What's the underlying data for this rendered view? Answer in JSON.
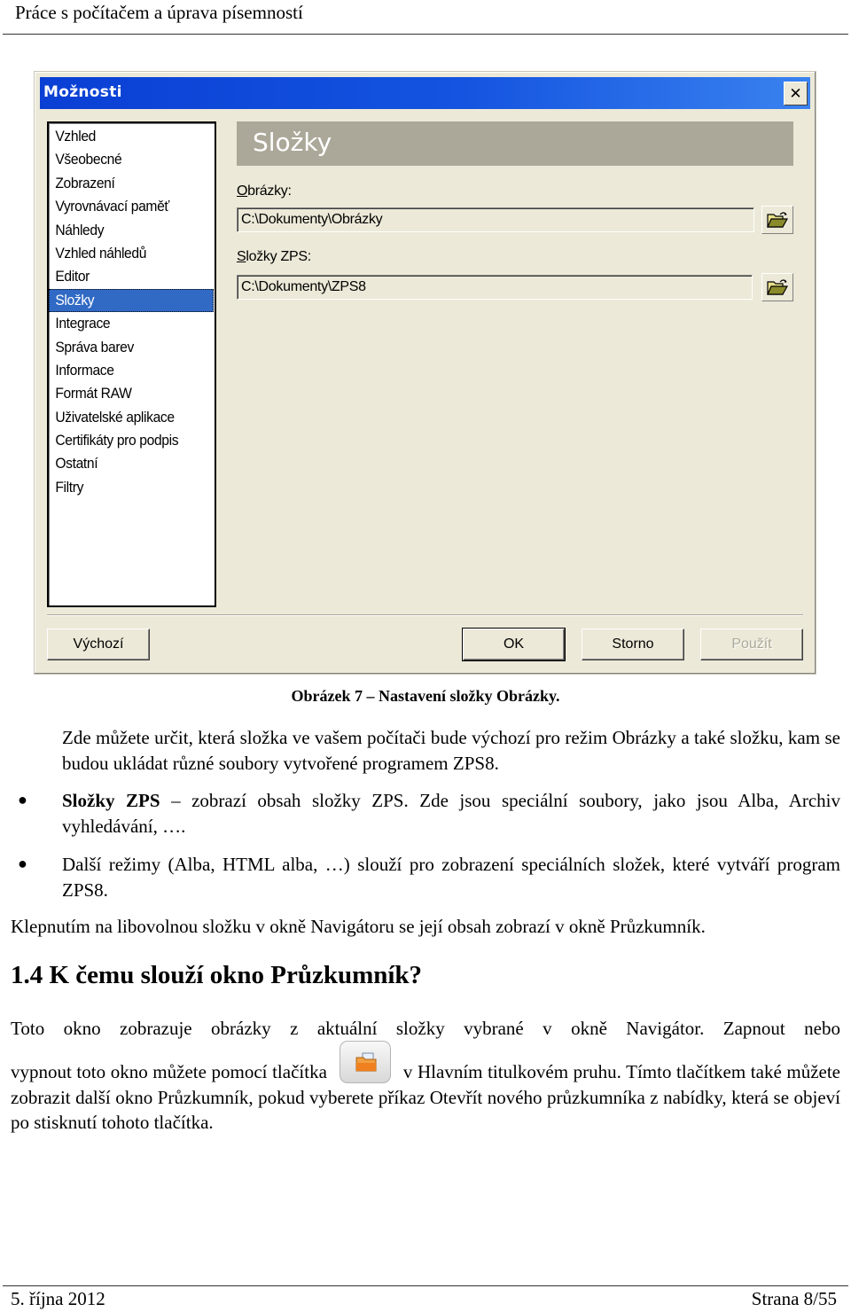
{
  "header": {
    "title": "Práce s počítačem a úprava písemností"
  },
  "dialog": {
    "title": "Možnosti",
    "close_icon": "close-icon",
    "nav_items": [
      {
        "label": "Vzhled",
        "selected": false
      },
      {
        "label": "Všeobecné",
        "selected": false
      },
      {
        "label": "Zobrazení",
        "selected": false
      },
      {
        "label": "Vyrovnávací paměť",
        "selected": false
      },
      {
        "label": "Náhledy",
        "selected": false
      },
      {
        "label": "Vzhled náhledů",
        "selected": false
      },
      {
        "label": "Editor",
        "selected": false
      },
      {
        "label": "Složky",
        "selected": true
      },
      {
        "label": "Integrace",
        "selected": false
      },
      {
        "label": "Správa barev",
        "selected": false
      },
      {
        "label": "Informace",
        "selected": false
      },
      {
        "label": "Formát RAW",
        "selected": false
      },
      {
        "label": "Uživatelské aplikace",
        "selected": false
      },
      {
        "label": "Certifikáty pro podpis",
        "selected": false
      },
      {
        "label": "Ostatní",
        "selected": false
      },
      {
        "label": "Filtry",
        "selected": false
      }
    ],
    "section_title": "Složky",
    "fields": [
      {
        "label_accel": "O",
        "label_rest": "brázky:",
        "value": "C:\\Dokumenty\\Obrázky",
        "button_icon": "open-folder-icon"
      },
      {
        "label_accel": "S",
        "label_rest": "ložky ZPS:",
        "value": "C:\\Dokumenty\\ZPS8",
        "button_icon": "open-folder-icon"
      }
    ],
    "buttons": {
      "default": "Výchozí",
      "ok": "OK",
      "cancel": "Storno",
      "apply": "Použít"
    }
  },
  "caption": "Obrázek 7 – Nastavení složky Obrázky.",
  "body": {
    "intro": "Zde můžete určit, která složka ve vašem počítači bude výchozí pro režim Obrázky a také složku, kam se budou ukládat různé soubory vytvořené programem ZPS8.",
    "bullet1_bold": "Složky ZPS",
    "bullet1_rest": " – zobrazí obsah složky ZPS. Zde jsou speciální soubory, jako jsou Alba, Archiv vyhledávání, ….",
    "bullet2": "Další režimy (Alba, HTML alba, …) slouží pro zobrazení speciálních složek, které vytváří program ZPS8.",
    "click_text": "Klepnutím na libovolnou složku v okně Navigátoru se její obsah zobrazí v okně Průzkumník.",
    "heading": "1.4  K čemu slouží okno Průzkumník?",
    "p1_line1": "Toto okno zobrazuje obrázky z aktuální složky vybrané v okně Navigátor. Zapnout nebo",
    "p1_before_icon": "vypnout toto okno můžete pomocí tlačítka",
    "p1_after_icon": "v Hlavním titulkovém pruhu. Tímto tlačítkem také můžete zobrazit další okno Průzkumník, pokud vyberete příkaz Otevřít nového průzkumníka z nabídky, která se objeví po stisknutí tohoto tlačítka.",
    "inline_icon": "explorer-folder-icon"
  },
  "footer": {
    "date": "5. října 2012",
    "page": "Strana 8/55"
  }
}
